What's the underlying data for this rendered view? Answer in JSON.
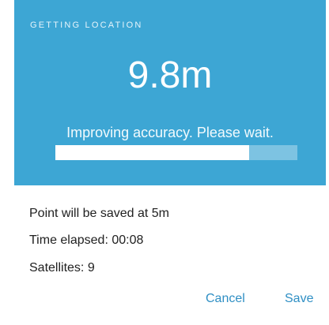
{
  "dialog": {
    "title": "GETTING LOCATION",
    "accuracy": "9.8m",
    "status": "Improving accuracy. Please wait.",
    "progress": 0.8,
    "colors": {
      "header_bg": "#3da6d4",
      "progress_fill": "#ffffff",
      "progress_track": "#7dc3e2",
      "action_text": "#2f8fc4"
    }
  },
  "details": {
    "save_distance_label": "Point will be saved at 5m",
    "time_elapsed_label": "Time elapsed: 00:08",
    "satellites_label": "Satellites: 9"
  },
  "actions": {
    "cancel": "Cancel",
    "save": "Save"
  }
}
